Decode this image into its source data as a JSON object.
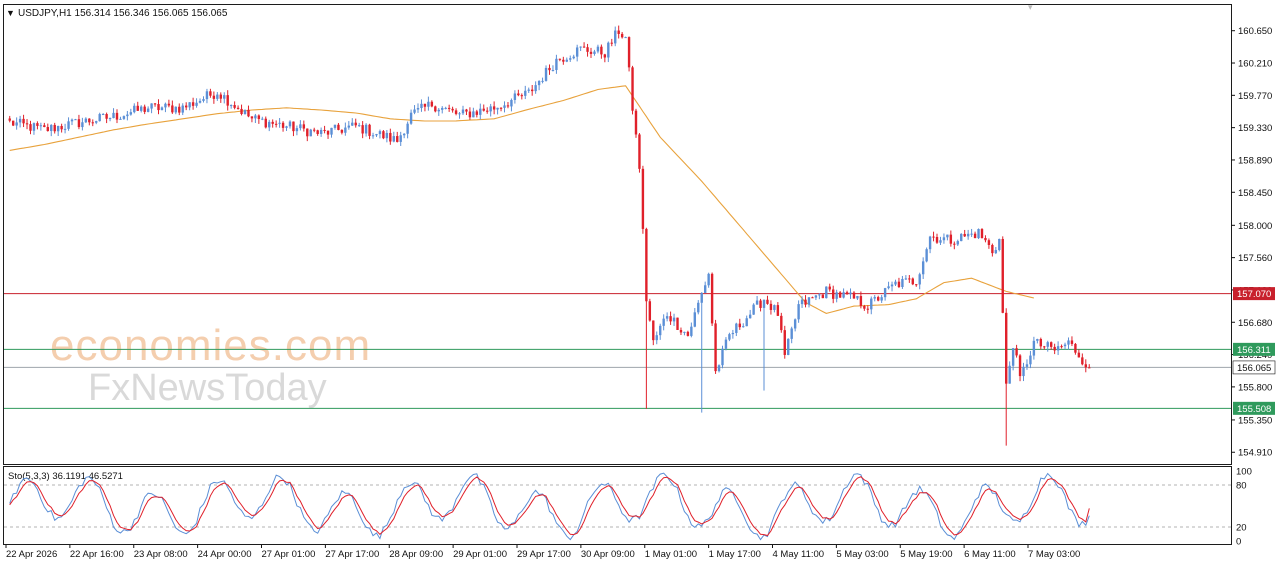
{
  "header": {
    "symbol_line": "USDJPY,H1  156.314 156.346 156.065 156.065"
  },
  "watermark": {
    "line1": "economies.com",
    "line2": "FxNewsToday"
  },
  "colors": {
    "bull": "#5b8fd6",
    "bear": "#e0202a",
    "ma": "#e8a23c",
    "level_red": "#c8202c",
    "level_green": "#2f9a5c",
    "price_line": "#9ea4ab",
    "sto_main": "#5b8fd6",
    "sto_signal": "#e0202a"
  },
  "chart_data": [
    {
      "type": "candlestick",
      "symbol": "USDJPY",
      "timeframe": "H1",
      "ylim": [
        154.75,
        161.0
      ],
      "y_ticks": [
        "160.650",
        "160.210",
        "159.770",
        "159.330",
        "158.890",
        "158.450",
        "158.000",
        "157.560",
        "157.120",
        "156.680",
        "156.240",
        "155.800",
        "155.350",
        "154.910"
      ],
      "x_ticks": [
        "22 Apr 2026",
        "22 Apr 16:00",
        "23 Apr 08:00",
        "24 Apr 00:00",
        "27 Apr 01:00",
        "27 Apr 17:00",
        "28 Apr 09:00",
        "29 Apr 01:00",
        "29 Apr 17:00",
        "30 Apr 09:00",
        "1 May 01:00",
        "1 May 17:00",
        "4 May 11:00",
        "5 May 03:00",
        "5 May 19:00",
        "6 May 11:00",
        "7 May 03:00"
      ],
      "last_price": "156.065",
      "levels": [
        {
          "label": "157.070",
          "value": 157.07,
          "color": "#c8202c"
        },
        {
          "label": "156.311",
          "value": 156.311,
          "color": "#2f9a5c"
        },
        {
          "label": "155.508",
          "value": 155.508,
          "color": "#2f9a5c"
        }
      ],
      "moving_average": [
        [
          0,
          159.02
        ],
        [
          10,
          159.1
        ],
        [
          20,
          159.2
        ],
        [
          30,
          159.3
        ],
        [
          40,
          159.38
        ],
        [
          50,
          159.45
        ],
        [
          60,
          159.52
        ],
        [
          70,
          159.57
        ],
        [
          80,
          159.6
        ],
        [
          90,
          159.57
        ],
        [
          100,
          159.53
        ],
        [
          110,
          159.45
        ],
        [
          120,
          159.42
        ],
        [
          128,
          159.42
        ],
        [
          140,
          159.45
        ],
        [
          150,
          159.58
        ],
        [
          160,
          159.7
        ],
        [
          170,
          159.85
        ],
        [
          178,
          159.9
        ],
        [
          188,
          159.2
        ],
        [
          200,
          158.6
        ],
        [
          210,
          158.05
        ],
        [
          220,
          157.5
        ],
        [
          230,
          156.95
        ],
        [
          236,
          156.8
        ],
        [
          244,
          156.9
        ],
        [
          254,
          156.92
        ],
        [
          262,
          157.0
        ],
        [
          270,
          157.22
        ],
        [
          278,
          157.28
        ],
        [
          288,
          157.1
        ],
        [
          296,
          157.01
        ]
      ],
      "ohlc_keypoints": [
        [
          0,
          159.4
        ],
        [
          10,
          159.3
        ],
        [
          20,
          159.4
        ],
        [
          30,
          159.48
        ],
        [
          40,
          159.6
        ],
        [
          50,
          159.6
        ],
        [
          60,
          159.82
        ],
        [
          70,
          159.45
        ],
        [
          80,
          159.35
        ],
        [
          90,
          159.25
        ],
        [
          100,
          159.35
        ],
        [
          112,
          159.15
        ],
        [
          116,
          159.5
        ],
        [
          122,
          159.65
        ],
        [
          130,
          159.5
        ],
        [
          140,
          159.6
        ],
        [
          150,
          159.8
        ],
        [
          158,
          160.25
        ],
        [
          165,
          160.4
        ],
        [
          172,
          160.35
        ],
        [
          176,
          160.65
        ],
        [
          178,
          160.55
        ],
        [
          180,
          159.6
        ],
        [
          182,
          158.8
        ],
        [
          184,
          157.0
        ],
        [
          186,
          156.4
        ],
        [
          190,
          156.8
        ],
        [
          196,
          156.5
        ],
        [
          202,
          157.35
        ],
        [
          204,
          156.0
        ],
        [
          208,
          156.5
        ],
        [
          214,
          156.8
        ],
        [
          218,
          157.0
        ],
        [
          222,
          156.8
        ],
        [
          224,
          156.2
        ],
        [
          228,
          156.9
        ],
        [
          236,
          157.1
        ],
        [
          244,
          157.0
        ],
        [
          248,
          156.9
        ],
        [
          256,
          157.2
        ],
        [
          262,
          157.25
        ],
        [
          266,
          157.85
        ],
        [
          272,
          157.8
        ],
        [
          280,
          157.9
        ],
        [
          284,
          157.65
        ],
        [
          286,
          157.8
        ],
        [
          288,
          155.8
        ],
        [
          290,
          156.4
        ],
        [
          292,
          155.9
        ],
        [
          296,
          156.4
        ],
        [
          302,
          156.3
        ],
        [
          306,
          156.4
        ],
        [
          308,
          156.3
        ],
        [
          312,
          156.06
        ]
      ],
      "spike_lows": [
        [
          184,
          155.5
        ],
        [
          200,
          155.45
        ],
        [
          218,
          155.75
        ],
        [
          288,
          155.0
        ]
      ]
    },
    {
      "type": "line",
      "name": "Stochastic",
      "label": "Sto(5,3,3) 36.1191 46.5271",
      "ylim": [
        0,
        100
      ],
      "y_ticks": [
        "100",
        "80",
        "20",
        "0"
      ],
      "levels": [
        80,
        20
      ]
    }
  ]
}
